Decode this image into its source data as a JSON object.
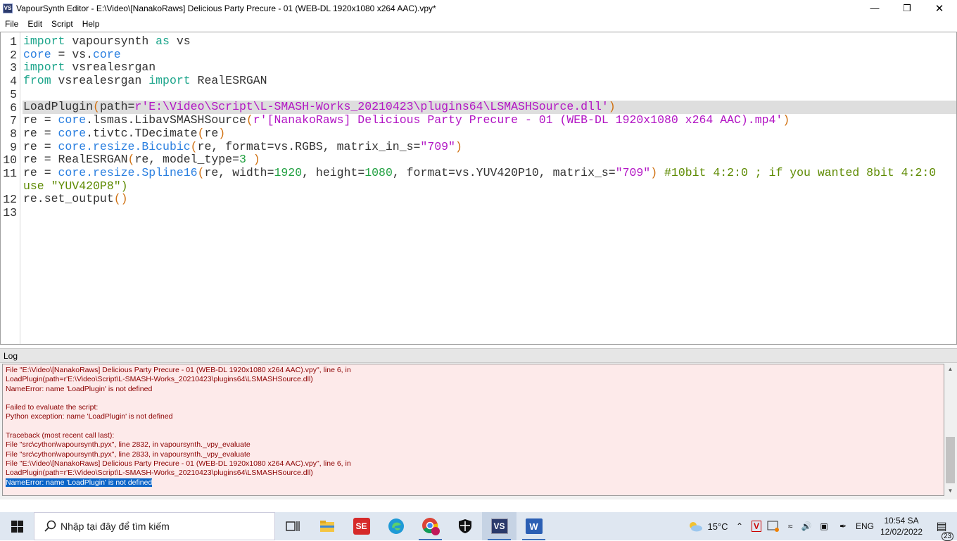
{
  "window": {
    "title": "VapourSynth Editor - E:\\Video\\[NanakoRaws] Delicious Party Precure - 01 (WEB-DL 1920x1080 x264 AAC).vpy*",
    "icon_label": "VS"
  },
  "menu": [
    "File",
    "Edit",
    "Script",
    "Help"
  ],
  "editor": {
    "current_line": 6,
    "lines": [
      {
        "n": "1",
        "t": [
          [
            "import",
            "kw"
          ],
          [
            " vapoursynth ",
            "tx"
          ],
          [
            "as",
            "kw"
          ],
          [
            " vs",
            "tx"
          ]
        ]
      },
      {
        "n": "2",
        "t": [
          [
            "core",
            "obj"
          ],
          [
            " = vs.",
            "tx"
          ],
          [
            "core",
            "obj"
          ]
        ]
      },
      {
        "n": "3",
        "t": [
          [
            "import",
            "kw"
          ],
          [
            " vsrealesrgan",
            "tx"
          ]
        ]
      },
      {
        "n": "4",
        "t": [
          [
            "from",
            "kw"
          ],
          [
            " vsrealesrgan ",
            "tx"
          ],
          [
            "import",
            "kw"
          ],
          [
            " RealESRGAN",
            "tx"
          ]
        ]
      },
      {
        "n": "5",
        "t": []
      },
      {
        "n": "6",
        "t": [
          [
            "LoadPlugin",
            "tx"
          ],
          [
            "(",
            "op"
          ],
          [
            "path=",
            "tx"
          ],
          [
            "r'E:\\Video\\Script\\L-SMASH-Works_20210423\\plugins64\\LSMASHSource.dll'",
            "str"
          ],
          [
            ")",
            "op"
          ]
        ]
      },
      {
        "n": "7",
        "t": [
          [
            "re = ",
            "tx"
          ],
          [
            "core",
            "obj"
          ],
          [
            ".lsmas.LibavSMASHSource",
            "tx"
          ],
          [
            "(",
            "op"
          ],
          [
            "r'[NanakoRaws] Delicious Party Precure - 01 (WEB-DL 1920x1080 x264 AAC).mp4'",
            "str"
          ],
          [
            ")",
            "op"
          ]
        ]
      },
      {
        "n": "8",
        "t": [
          [
            "re = ",
            "tx"
          ],
          [
            "core",
            "obj"
          ],
          [
            ".tivtc.TDecimate",
            "tx"
          ],
          [
            "(",
            "op"
          ],
          [
            "re",
            "tx"
          ],
          [
            ")",
            "op"
          ]
        ]
      },
      {
        "n": "9",
        "t": [
          [
            "re = ",
            "tx"
          ],
          [
            "core.resize.Bicubic",
            "obj"
          ],
          [
            "(",
            "op"
          ],
          [
            "re, format=vs.RGBS, matrix_in_s=",
            "tx"
          ],
          [
            "\"709\"",
            "str"
          ],
          [
            ")",
            "op"
          ]
        ]
      },
      {
        "n": "10",
        "t": [
          [
            "re = RealESRGAN",
            "tx"
          ],
          [
            "(",
            "op"
          ],
          [
            "re, model_type=",
            "tx"
          ],
          [
            "3",
            "num"
          ],
          [
            " )",
            "op"
          ]
        ]
      },
      {
        "n": "11",
        "t": [
          [
            "re = ",
            "tx"
          ],
          [
            "core.resize.Spline16",
            "obj"
          ],
          [
            "(",
            "op"
          ],
          [
            "re, width=",
            "tx"
          ],
          [
            "1920",
            "num"
          ],
          [
            ", height=",
            "tx"
          ],
          [
            "1080",
            "num"
          ],
          [
            ", format=vs.YUV420P10, matrix_s=",
            "tx"
          ],
          [
            "\"709\"",
            "str"
          ],
          [
            ")",
            "op"
          ],
          [
            " #10bit 4:2:0 ; if you wanted 8bit 4:2:0",
            "cm"
          ]
        ]
      },
      {
        "n": "",
        "t": [
          [
            "use \"YUV420P8\")",
            "cm"
          ]
        ]
      },
      {
        "n": "12",
        "t": [
          [
            "re.set_output",
            "tx"
          ],
          [
            "()",
            "op"
          ]
        ]
      },
      {
        "n": "13",
        "t": []
      }
    ]
  },
  "log": {
    "title": "Log",
    "lines": [
      "File \"E:\\Video\\[NanakoRaws] Delicious Party Precure - 01 (WEB-DL 1920x1080 x264 AAC).vpy\", line 6, in",
      "LoadPlugin(path=r'E:\\Video\\Script\\L-SMASH-Works_20210423\\plugins64\\LSMASHSource.dll)",
      "NameError: name 'LoadPlugin' is not defined",
      "",
      "Failed to evaluate the script:",
      "Python exception: name 'LoadPlugin' is not defined",
      "",
      "Traceback (most recent call last):",
      "File \"src\\cython\\vapoursynth.pyx\", line 2832, in vapoursynth._vpy_evaluate",
      "File \"src\\cython\\vapoursynth.pyx\", line 2833, in vapoursynth._vpy_evaluate",
      "File \"E:\\Video\\[NanakoRaws] Delicious Party Precure - 01 (WEB-DL 1920x1080 x264 AAC).vpy\", line 6, in",
      "LoadPlugin(path=r'E:\\Video\\Script\\L-SMASH-Works_20210423\\plugins64\\LSMASHSource.dll)",
      "NameError: name 'LoadPlugin' is not defined"
    ],
    "selected_line": 12
  },
  "taskbar": {
    "search_placeholder": "Nhập tại đây để tìm kiếm",
    "weather": "15°C",
    "language": "ENG",
    "time": "10:54 SA",
    "date": "12/02/2022",
    "notifications": "23",
    "vs_label": "VS",
    "se_label": "SE",
    "word_label": "W"
  }
}
